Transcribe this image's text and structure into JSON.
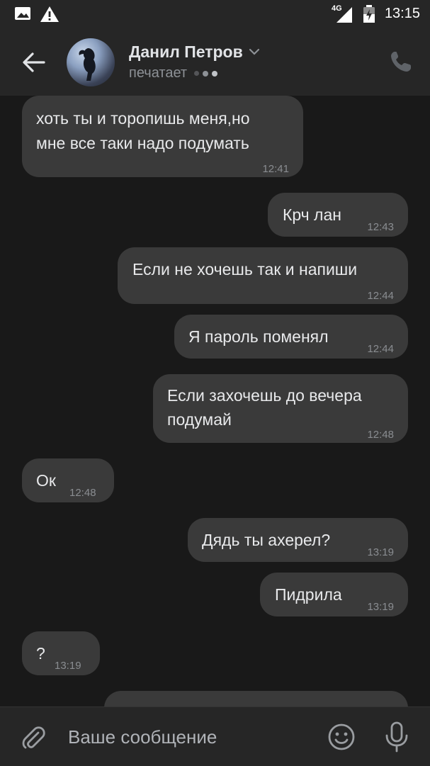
{
  "status_bar": {
    "network": "4G",
    "time": "13:15",
    "icons": [
      "image-icon",
      "warning-icon",
      "signal-icon",
      "battery-icon"
    ]
  },
  "header": {
    "name": "Данил Петров",
    "status": "печатает"
  },
  "messages": [
    {
      "direction": "in",
      "text": "хоть ты и торопишь меня,но мне все таки надо подумать",
      "line1": "хоть ты и торопишь меня,но",
      "line2": "мне все таки надо подумать",
      "time": "12:41"
    },
    {
      "direction": "out",
      "text": "Крч лан",
      "time": "12:43"
    },
    {
      "direction": "out",
      "text": "Если не хочешь так и напиши",
      "time": "12:44"
    },
    {
      "direction": "out",
      "text": "Я пароль поменял",
      "time": "12:44"
    },
    {
      "direction": "out",
      "text": "Если захочешь до вечера подумай",
      "line1": "Если захочешь до вечера",
      "line2": "подумай",
      "time": "12:48"
    },
    {
      "direction": "in",
      "text": "Ок",
      "time": "12:48"
    },
    {
      "direction": "out",
      "text": "Дядь ты ахерел?",
      "time": "13:19"
    },
    {
      "direction": "out",
      "text": "Пидрила",
      "time": "13:19"
    },
    {
      "direction": "in",
      "text": "?",
      "time": "13:19"
    }
  ],
  "input": {
    "placeholder": "Ваше сообщение"
  },
  "colors": {
    "background": "#191919",
    "bar": "#262626",
    "bubble": "#3a3a3a",
    "text": "#e8e9eb",
    "muted": "#8d9196"
  }
}
